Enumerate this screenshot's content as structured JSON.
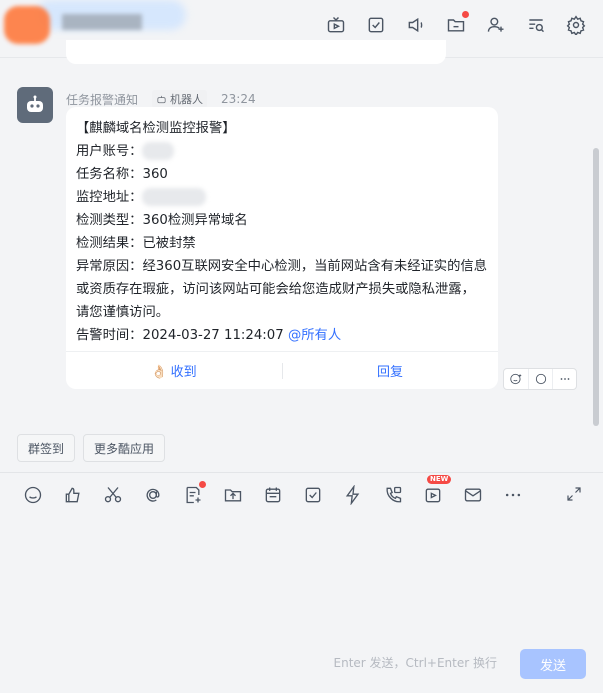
{
  "header": {
    "icons": [
      "video-icon",
      "todo-check-icon",
      "announcement-icon",
      "folder-icon",
      "add-member-icon",
      "search-chat-icon",
      "settings-icon"
    ]
  },
  "message": {
    "sender": "任务报警通知",
    "sender_tag": "机器人",
    "time": "23:24",
    "title": "【麒麟域名检测监控报警】",
    "fields": {
      "account_label": "用户账号：",
      "task_label": "任务名称：",
      "task_value": "360",
      "monitor_label": "监控地址：",
      "type_label": "检测类型：",
      "type_value": "360检测异常域名",
      "result_label": "检测结果：",
      "result_value": "已被封禁",
      "reason_label": "异常原因：",
      "reason_value": "经360互联网安全中心检测，当前网站含有未经证实的信息或资质存在瑕疵，访问该网站可能会给您造成财产损失或隐私泄露，请您谨慎访问。",
      "alert_time_label": "告警时间：",
      "alert_time_value": "2024-03-27 11:24:07",
      "mention": "@所有人"
    },
    "actions": {
      "received_emoji": "👌🏻",
      "received": "收到",
      "reply": "回复"
    }
  },
  "quick_chips": [
    "群签到",
    "更多酷应用"
  ],
  "composer": {
    "tool_icons": [
      "emoji-icon",
      "thumbs-up-icon",
      "scissors-icon",
      "at-icon",
      "doc-add-icon",
      "upload-file-icon",
      "calendar-icon",
      "task-icon",
      "flash-icon",
      "phone-icon",
      "video-meeting-icon",
      "mail-icon",
      "more-icon"
    ],
    "new_badge": "NEW",
    "hint": "Enter 发送，Ctrl+Enter 换行",
    "send": "发送"
  },
  "colors": {
    "accent": "#3370ff",
    "badge_red": "#f54a45",
    "send_disabled": "#a8c4ff"
  }
}
